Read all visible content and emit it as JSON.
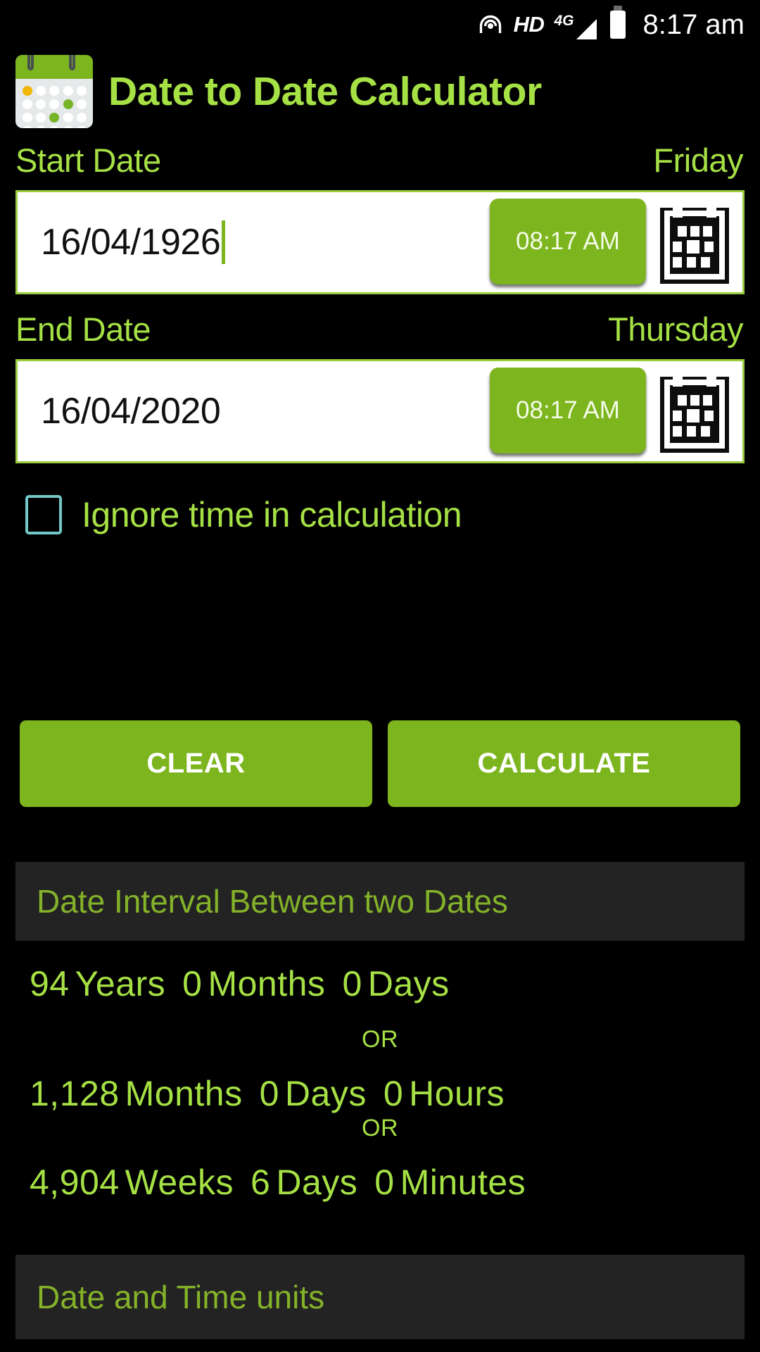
{
  "status_bar": {
    "volte_icon": "hotspot-signal-icon",
    "hd_label": "HD",
    "network_label": "4G",
    "signal_icon": "signal-bars-icon",
    "battery_icon": "battery-icon",
    "time": "8:17 am"
  },
  "app": {
    "icon": "calendar-app-icon",
    "title": "Date to Date Calculator"
  },
  "start_date": {
    "label": "Start Date",
    "weekday": "Friday",
    "value": "16/04/1926",
    "time": "08:17 AM",
    "calendar_icon": "calendar-picker-icon"
  },
  "end_date": {
    "label": "End Date",
    "weekday": "Thursday",
    "value": "16/04/2020",
    "time": "08:17 AM",
    "calendar_icon": "calendar-picker-icon"
  },
  "ignore_time": {
    "label": "Ignore time in calculation",
    "checked": false
  },
  "actions": {
    "clear_label": "CLEAR",
    "calculate_label": "CALCULATE"
  },
  "interval_section": {
    "header": "Date Interval Between two Dates",
    "or_label": "OR",
    "lines": [
      {
        "v1": "94",
        "u1": "Years",
        "v2": "0",
        "u2": "Months",
        "v3": "0",
        "u3": "Days"
      },
      {
        "v1": "1,128",
        "u1": "Months",
        "v2": "0",
        "u2": "Days",
        "v3": "0",
        "u3": "Hours"
      },
      {
        "v1": "4,904",
        "u1": "Weeks",
        "v2": "6",
        "u2": "Days",
        "v3": "0",
        "u3": "Minutes"
      }
    ]
  },
  "units_section": {
    "header": "Date and Time units"
  },
  "colors": {
    "background": "#000000",
    "accent_green": "#7cb51e",
    "text_green": "#a5e044",
    "band_green": "#84b229",
    "band_bg": "#232323",
    "checkbox_border": "#74c7c7",
    "field_bg": "#ffffff"
  }
}
